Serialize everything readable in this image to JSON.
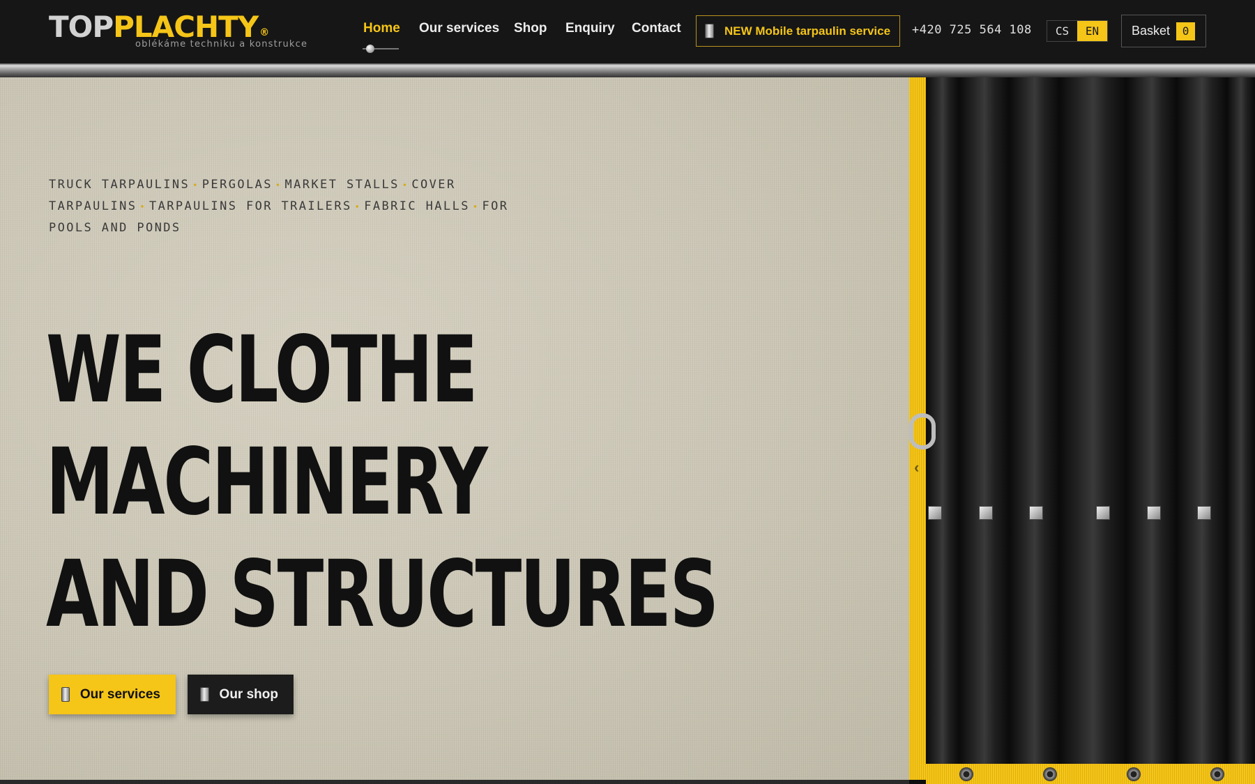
{
  "brand": {
    "logo_top": "TOP",
    "logo_plachty": "PLACHTY",
    "logo_reg": "®",
    "tagline": "oblékáme techniku a konstrukce"
  },
  "nav": {
    "items": [
      {
        "label": "Home",
        "active": true
      },
      {
        "label": "Our services",
        "active": false
      },
      {
        "label": "Shop",
        "active": false
      },
      {
        "label": "Enquiry",
        "active": false
      },
      {
        "label": "Contact",
        "active": false
      }
    ]
  },
  "promo": {
    "label": "NEW Mobile tarpaulin service"
  },
  "contact": {
    "phone": "+420 725 564 108"
  },
  "language": {
    "options": [
      "CS",
      "EN"
    ],
    "selected": "EN"
  },
  "basket": {
    "label": "Basket",
    "count": "0"
  },
  "hero": {
    "categories": [
      "TRUCK TARPAULINS",
      "PERGOLAS",
      "MARKET STALLS",
      "COVER TARPAULINS",
      "TARPAULINS FOR TRAILERS",
      "FABRIC HALLS",
      "FOR POOLS AND PONDS"
    ],
    "title_lines": [
      "WE CLOTHE",
      "MACHINERY",
      "AND STRUCTURES"
    ],
    "buttons": {
      "services": "Our services",
      "shop": "Our shop"
    }
  },
  "icons": {
    "phone": "phone-icon",
    "hook": "hook-icon",
    "arrow": "chevron-left-icon"
  },
  "colors": {
    "accent": "#f5c518",
    "header_bg": "#161616",
    "hero_bg": "#cbc6b5",
    "title": "#111111"
  }
}
